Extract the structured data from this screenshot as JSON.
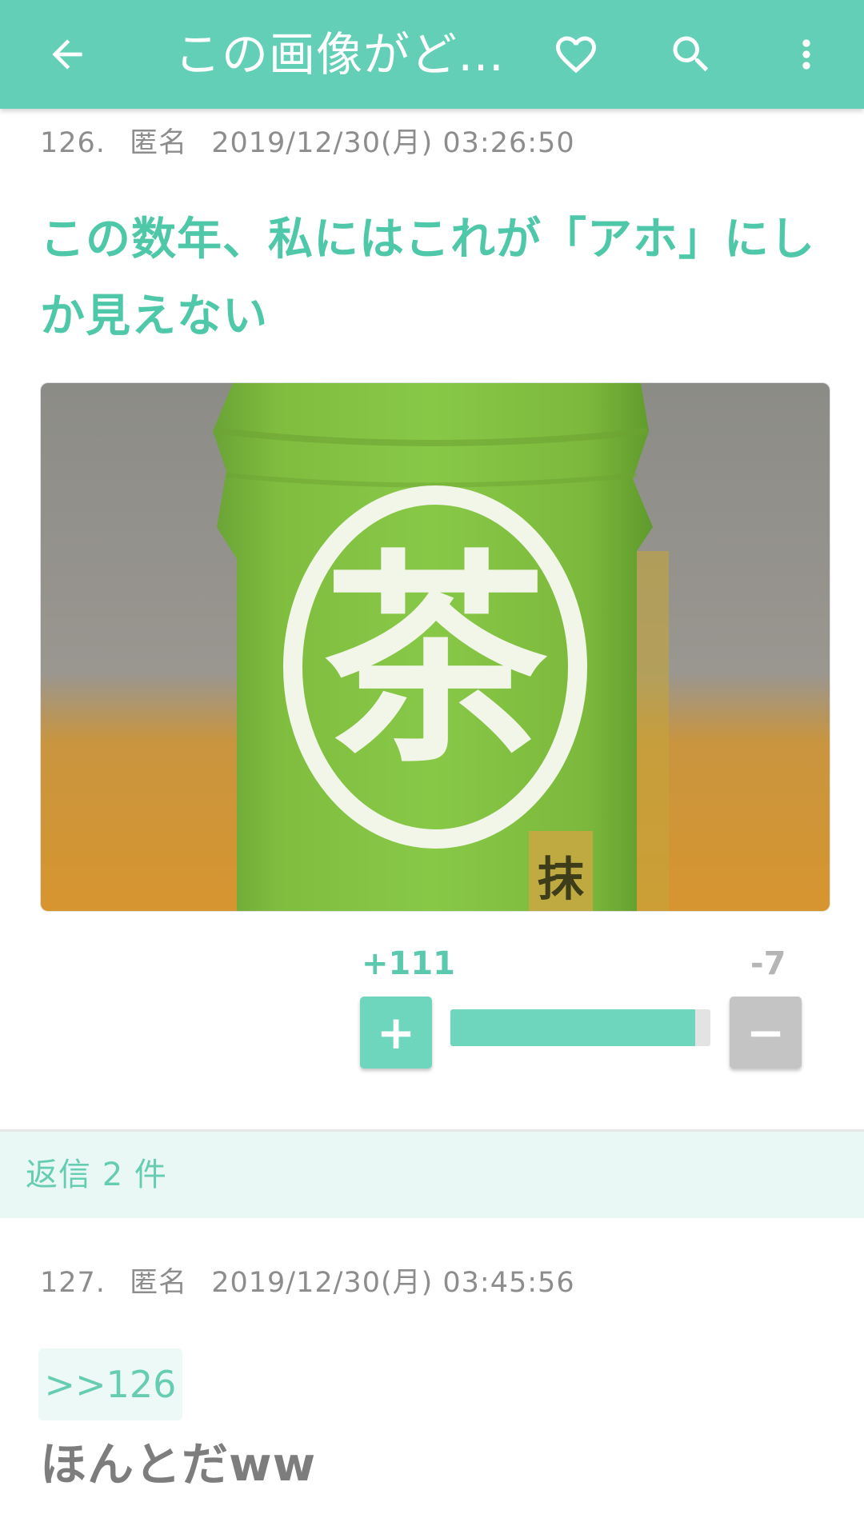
{
  "theme": {
    "accent": "#62cfb6",
    "vote_plus_color": "#6fd6be",
    "vote_minus_color": "#c4c4c4"
  },
  "appbar": {
    "title": "この画像がど…",
    "icons": [
      "arrow-back-icon",
      "heart-icon",
      "search-icon",
      "more-vert-icon"
    ]
  },
  "post": {
    "number": "126.",
    "author": "匿名",
    "datetime": "2019/12/30(月) 03:26:50",
    "body": "この数年、私にはこれが「アホ」にしか見えない",
    "image": {
      "visible_glyph": "茶",
      "small_glyph": "抹"
    },
    "votes": {
      "plus_label": "+111",
      "minus_label": "-7",
      "plus_button_label": "+",
      "minus_button_label": "−",
      "plus": 111,
      "minus": 7,
      "ratio": 0.94
    }
  },
  "replies_banner": {
    "label": "返信 2 件"
  },
  "reply": {
    "number": "127.",
    "author": "匿名",
    "datetime": "2019/12/30(月) 03:45:56",
    "anchor": ">>126",
    "body": "ほんとだww"
  }
}
